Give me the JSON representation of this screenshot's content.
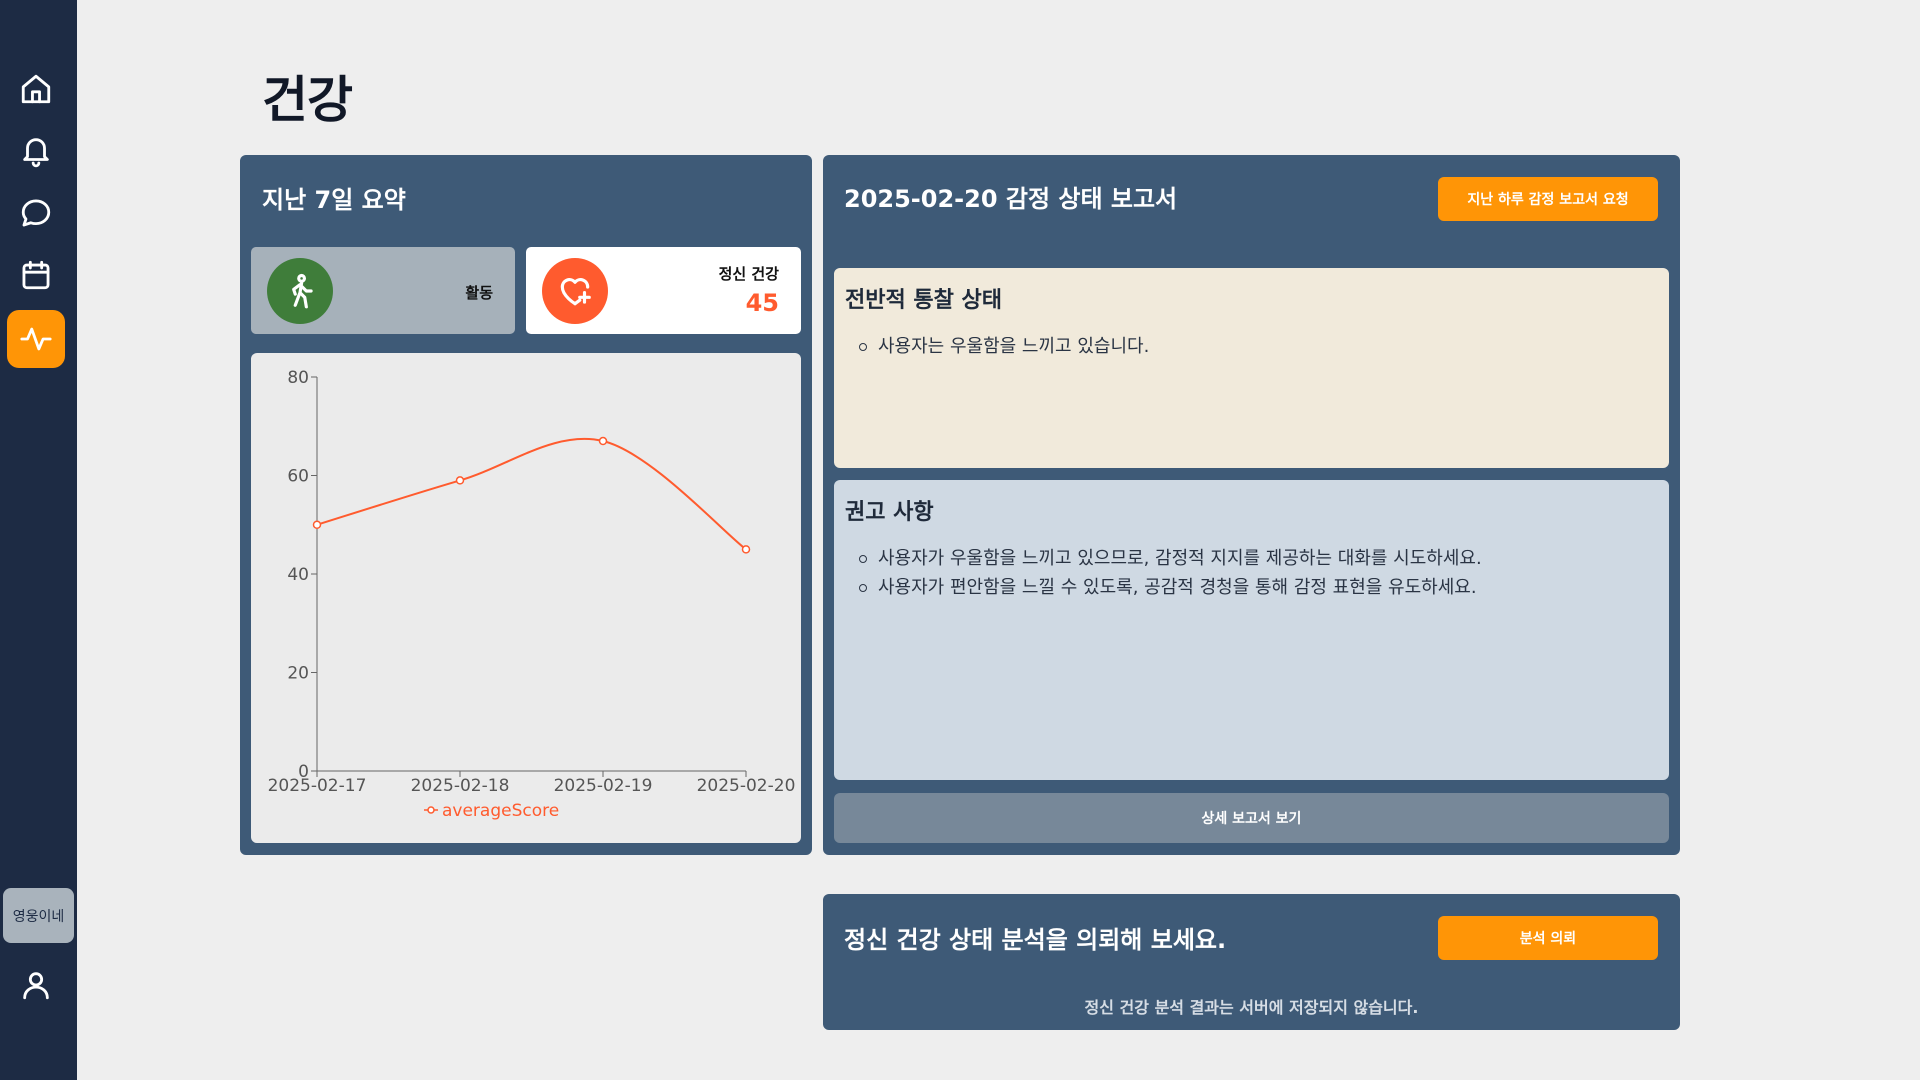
{
  "page": {
    "title": "건강"
  },
  "sidebar": {
    "items": [
      {
        "name": "home",
        "icon": "home-icon"
      },
      {
        "name": "notifications",
        "icon": "bell-icon"
      },
      {
        "name": "chat",
        "icon": "chat-bubble-icon"
      },
      {
        "name": "calendar",
        "icon": "calendar-icon"
      },
      {
        "name": "health",
        "icon": "activity-pulse-icon",
        "active": true
      }
    ],
    "user_name": "영웅이네",
    "profile_icon": "user-icon"
  },
  "summary": {
    "title": "지난 7일 요약",
    "activity": {
      "label": "활동",
      "icon": "walking-person-icon",
      "color": "#3f7d3a"
    },
    "mental": {
      "label": "정신 건강",
      "value": "45",
      "icon": "heart-plus-icon",
      "color": "#ff5b2e"
    }
  },
  "chart_data": {
    "type": "line",
    "x": [
      "2025-02-17",
      "2025-02-18",
      "2025-02-19",
      "2025-02-20"
    ],
    "series": [
      {
        "name": "averageScore",
        "values": [
          50,
          59,
          67,
          45
        ],
        "color": "#ff5b2e"
      }
    ],
    "ylim": [
      0,
      80
    ],
    "yticks": [
      0,
      20,
      40,
      60,
      80
    ],
    "grid": false,
    "legend": "bottom-center"
  },
  "report": {
    "title": "2025-02-20 감정 상태 보고서",
    "request_button": "지난 하루 감정 보고서 요청",
    "insight": {
      "heading": "전반적 통찰 상태",
      "items": [
        "사용자는 우울함을 느끼고 있습니다."
      ]
    },
    "recommend": {
      "heading": "권고 사항",
      "items": [
        "사용자가 우울함을 느끼고 있으므로, 감정적 지지를 제공하는 대화를 시도하세요.",
        "사용자가 편안함을 느낄 수 있도록, 공감적 경청을 통해 감정 표현을 유도하세요."
      ]
    },
    "detail_button": "상세 보고서 보기"
  },
  "analysis": {
    "title": "정신 건강 상태 분석을 의뢰해 보세요.",
    "button": "분석 의뢰",
    "note": "정신 건강 분석 결과는 서버에 저장되지 않습니다."
  }
}
